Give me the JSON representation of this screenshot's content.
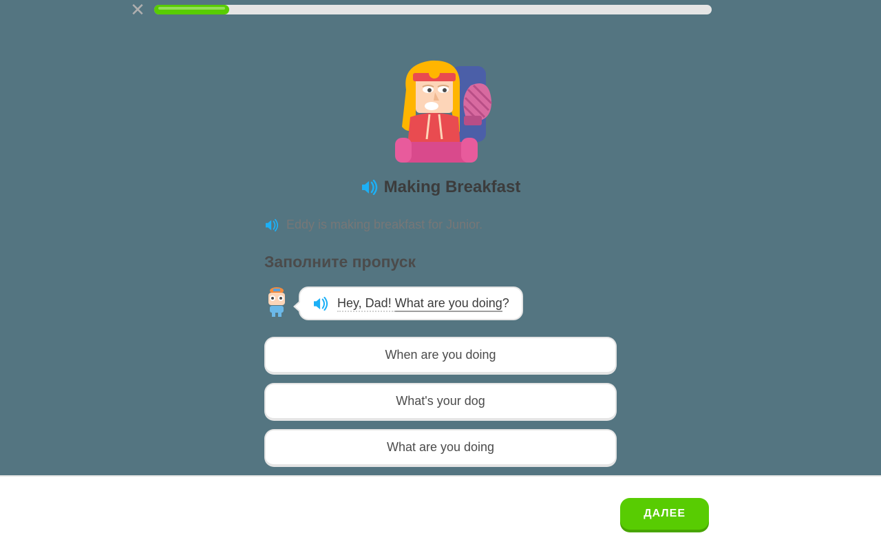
{
  "progress": {
    "percent": 13.5
  },
  "title": "Making Breakfast",
  "context_line": "Eddy is making breakfast for Junior.",
  "prompt_label": "Заполните пропуск",
  "bubble": {
    "prefix": "Hey, Dad! ",
    "blank_text": "What are you doing",
    "suffix": "?"
  },
  "options": [
    "When are you doing",
    "What's your dog",
    "What are you doing"
  ],
  "next_button": "ДАЛЕЕ",
  "colors": {
    "accent_blue": "#1cb0f6",
    "green": "#58cc02"
  }
}
